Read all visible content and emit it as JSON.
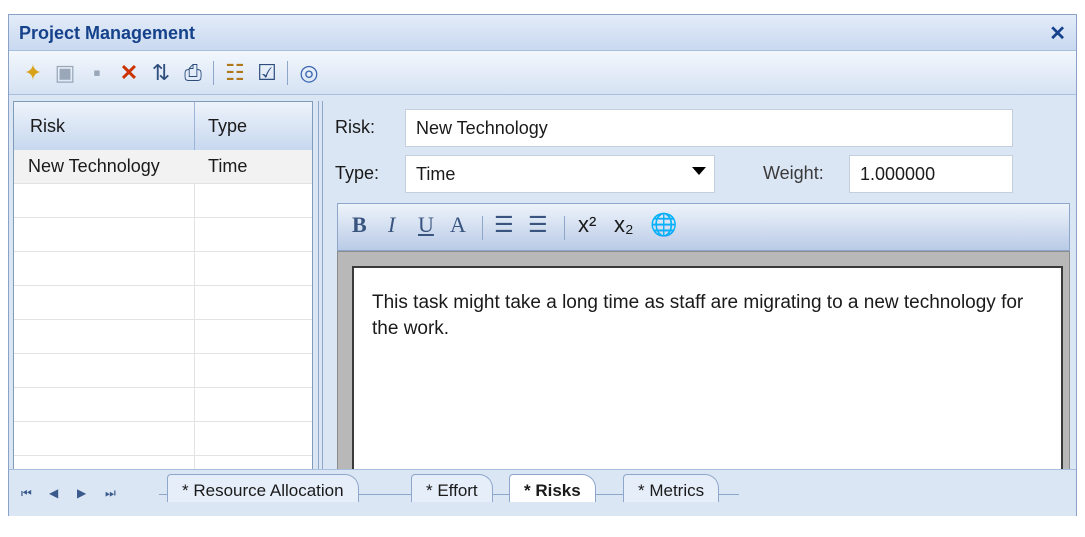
{
  "window": {
    "title": "Project Management",
    "close_glyph": "✕"
  },
  "toolbar": {
    "icons": [
      "new-icon",
      "save-icon",
      "copy-icon",
      "delete-icon",
      "sort-icon",
      "print-icon",
      "hierarchy-icon",
      "properties-icon",
      "help-icon"
    ],
    "glyphs": {
      "new": "✦",
      "save": "▣",
      "copy": "▪",
      "delete": "✕",
      "sort": "⇅",
      "print": "⎙",
      "hierarchy": "☷",
      "properties": "☑",
      "help": "◎"
    }
  },
  "risk_list": {
    "columns": [
      "Risk",
      "Type"
    ],
    "rows": [
      {
        "risk": "New Technology",
        "type": "Time"
      }
    ]
  },
  "form": {
    "risk_label": "Risk:",
    "risk_value": "New Technology",
    "type_label": "Type:",
    "type_value": "Time",
    "weight_label": "Weight:",
    "weight_value": "1.000000"
  },
  "rich_text": {
    "bold": "B",
    "italic": "I",
    "underline": "U",
    "font_color": "A",
    "bullets": "☰",
    "numbering": "☰",
    "superscript": "x²",
    "subscript": "x₂",
    "hyperlink": "🌐",
    "content": "This task might take a long time as staff are migrating to a new technology for the work."
  },
  "nav_glyphs": {
    "first": "⏮",
    "prev": "◀",
    "next": "▶",
    "last": "⏭"
  },
  "tabs": [
    "* Resource Allocation",
    "* Effort",
    "* Risks",
    "* Metrics"
  ],
  "active_tab": "* Risks",
  "colors": {
    "title_text": "#15428b",
    "panel_bg": "#dbe6f5",
    "accent_red": "#cc3300"
  }
}
